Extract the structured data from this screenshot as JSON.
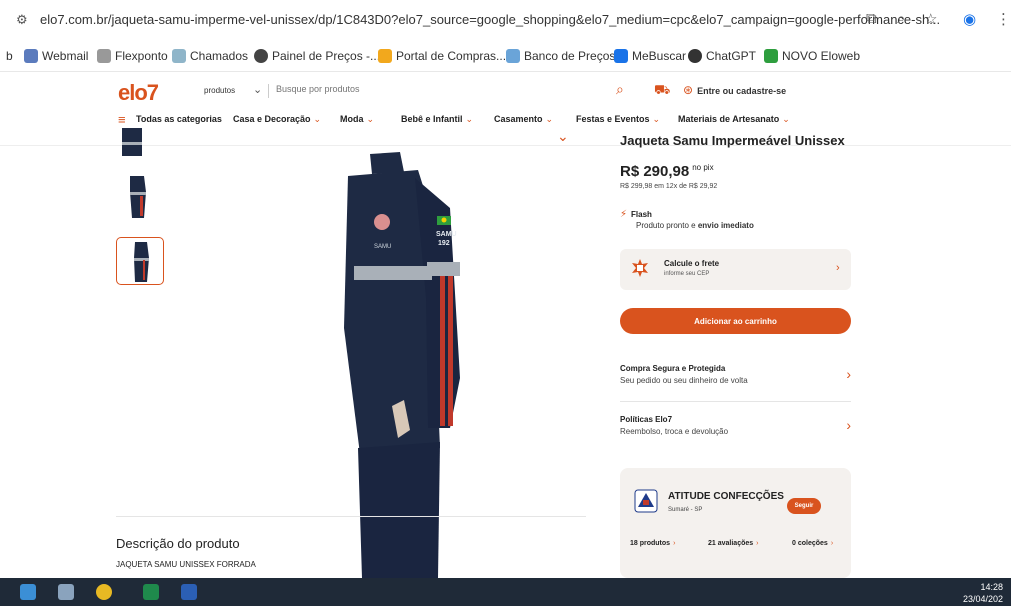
{
  "browser": {
    "url": "elo7.com.br/jaqueta-samu-imperme-vel-unissex/dp/1C843D0?elo7_source=google_shopping&elo7_medium=cpc&elo7_campaign=google-performance-sh...",
    "bookmarks": [
      {
        "label": "b",
        "icon": "letter-icon"
      },
      {
        "label": "Webmail",
        "icon": "webmail-icon"
      },
      {
        "label": "Flexponto",
        "icon": "hourglass-icon"
      },
      {
        "label": "Chamados",
        "icon": "shield-icon"
      },
      {
        "label": "Painel de Preços -...",
        "icon": "globe-icon"
      },
      {
        "label": "Portal de Compras...",
        "icon": "compras-icon"
      },
      {
        "label": "Banco de Preços",
        "icon": "banco-icon"
      },
      {
        "label": "MeBuscar",
        "icon": "mebuscar-icon"
      },
      {
        "label": "ChatGPT",
        "icon": "chatgpt-icon"
      },
      {
        "label": "NOVO Eloweb",
        "icon": "eloweb-icon"
      }
    ]
  },
  "header": {
    "logo": "elo7",
    "search_scope": "produtos",
    "search_placeholder": "Busque por produtos",
    "login_label": "Entre ou cadastre-se",
    "categories": [
      {
        "label": "Todas as categorias",
        "chevron": false
      },
      {
        "label": "Casa e Decoração",
        "chevron": true
      },
      {
        "label": "Moda",
        "chevron": true
      },
      {
        "label": "Bebê e Infantil",
        "chevron": true
      },
      {
        "label": "Casamento",
        "chevron": true
      },
      {
        "label": "Festas e Eventos",
        "chevron": true
      },
      {
        "label": "Materiais de Artesanato",
        "chevron": true
      }
    ]
  },
  "product": {
    "title": "Jaqueta Samu Impermeável Unissex",
    "price": "R$ 290,98",
    "price_suffix": "no pix",
    "installment": "R$ 299,98 em 12x de R$ 29,92",
    "flash_title": "Flash",
    "flash_desc_prefix": "Produto pronto e ",
    "flash_desc_bold": "envio imediato",
    "freight_title": "Calcule o frete",
    "freight_sub": "informe seu CEP",
    "add_to_cart": "Adicionar ao carrinho",
    "safe_title": "Compra Segura e Protegida",
    "safe_sub": "Seu pedido ou seu dinheiro de volta",
    "policy_title": "Políticas Elo7",
    "policy_sub": "Reembolso, troca e devolução",
    "jacket_badge_a": "SAMU",
    "jacket_badge_b": "192"
  },
  "seller": {
    "name": "ATITUDE CONFECÇÕES",
    "location": "Sumaré - SP",
    "follow": "Seguir",
    "products": "18 produtos",
    "reviews": "21 avaliações",
    "collections": "0 coleções"
  },
  "description": {
    "heading": "Descrição do produto",
    "text": "JAQUETA SAMU UNISSEX FORRADA"
  },
  "taskbar": {
    "time": "14:28",
    "date": "23/04/202"
  },
  "colors": {
    "accent": "#d9531e",
    "jacket": "#1e2a44",
    "taskbar": "#1f2a38"
  }
}
